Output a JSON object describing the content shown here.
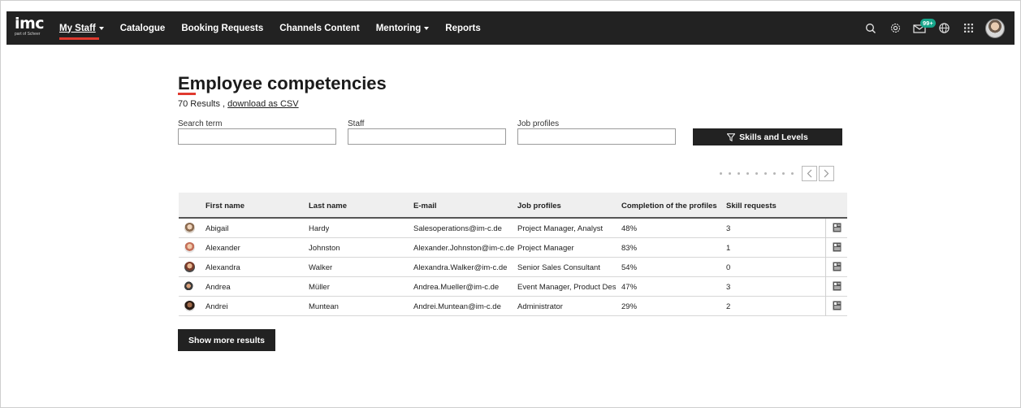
{
  "nav": {
    "logo_text": "imc",
    "logo_sub": "part of Scheer",
    "items": [
      {
        "label": "My Staff",
        "has_caret": true,
        "active": true
      },
      {
        "label": "Catalogue",
        "has_caret": false
      },
      {
        "label": "Booking Requests",
        "has_caret": false
      },
      {
        "label": "Channels Content",
        "has_caret": false
      },
      {
        "label": "Mentoring",
        "has_caret": true
      },
      {
        "label": "Reports",
        "has_caret": false
      }
    ],
    "messages_badge": "99+",
    "icons": [
      "search-icon",
      "settings-icon",
      "messages-icon",
      "language-icon",
      "apps-grid-icon",
      "user-avatar"
    ]
  },
  "page": {
    "title": "Employee competencies",
    "results_count": "70 Results ,",
    "download_link": "download as CSV"
  },
  "filters": {
    "search_label": "Search term",
    "search_value": "",
    "staff_label": "Staff",
    "staff_value": "",
    "job_profiles_label": "Job profiles",
    "job_profiles_value": "",
    "skills_button": "Skills and Levels"
  },
  "table": {
    "headers": [
      "First name",
      "Last name",
      "E-mail",
      "Job profiles",
      "Completion of the profiles",
      "Skill requests"
    ],
    "rows": [
      {
        "first": "Abigail",
        "last": "Hardy",
        "email": "Salesoperations@im-c.de",
        "job": "Project Manager, Analyst",
        "completion": "48%",
        "requests": "3"
      },
      {
        "first": "Alexander",
        "last": "Johnston",
        "email": "Alexander.Johnston@im-c.de",
        "job": "Project Manager",
        "completion": "83%",
        "requests": "1"
      },
      {
        "first": "Alexandra",
        "last": "Walker",
        "email": "Alexandra.Walker@im-c.de",
        "job": "Senior Sales Consultant",
        "completion": "54%",
        "requests": "0"
      },
      {
        "first": "Andrea",
        "last": "Müller",
        "email": "Andrea.Mueller@im-c.de",
        "job": "Event Manager, Product Des...",
        "completion": "47%",
        "requests": "3"
      },
      {
        "first": "Andrei",
        "last": "Muntean",
        "email": "Andrei.Muntean@im-c.de",
        "job": "Administrator",
        "completion": "29%",
        "requests": "2"
      }
    ]
  },
  "show_more_button": "Show more results",
  "colors": {
    "nav_bg": "#222222",
    "accent_red": "#e03a2f",
    "badge_green": "#17a58a",
    "button_dark": "#222222"
  }
}
